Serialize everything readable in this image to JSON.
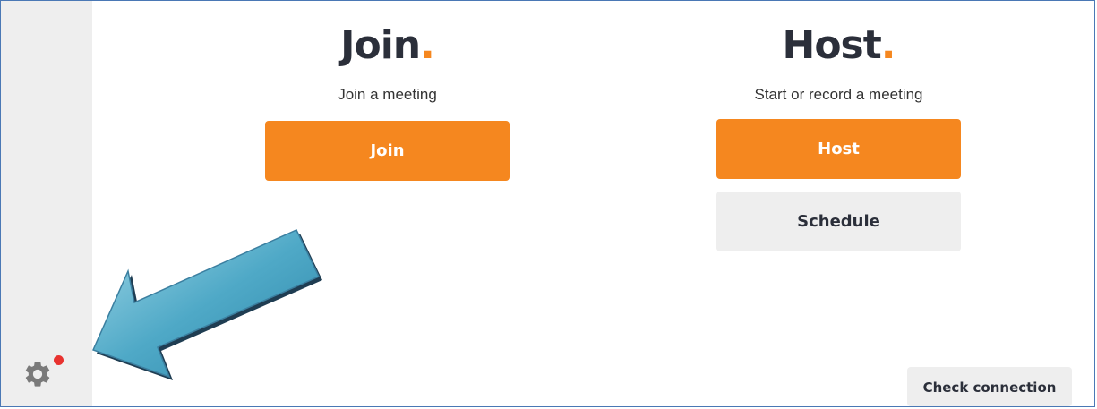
{
  "sidebar": {
    "settings_icon": "gear-icon",
    "notification": true,
    "notification_color": "#e8322f"
  },
  "join": {
    "heading": "Join",
    "heading_dot": ".",
    "subtitle": "Join a meeting",
    "button_label": "Join"
  },
  "host": {
    "heading": "Host",
    "heading_dot": ".",
    "subtitle": "Start or record a meeting",
    "button_label": "Host",
    "schedule_label": "Schedule"
  },
  "footer": {
    "check_connection_label": "Check connection"
  },
  "colors": {
    "accent": "#f5871f",
    "heading": "#2b2f3a",
    "secondary_button": "#eeeeee",
    "sidebar": "#eeeeee",
    "annotation_arrow": "#5ab3cf"
  }
}
